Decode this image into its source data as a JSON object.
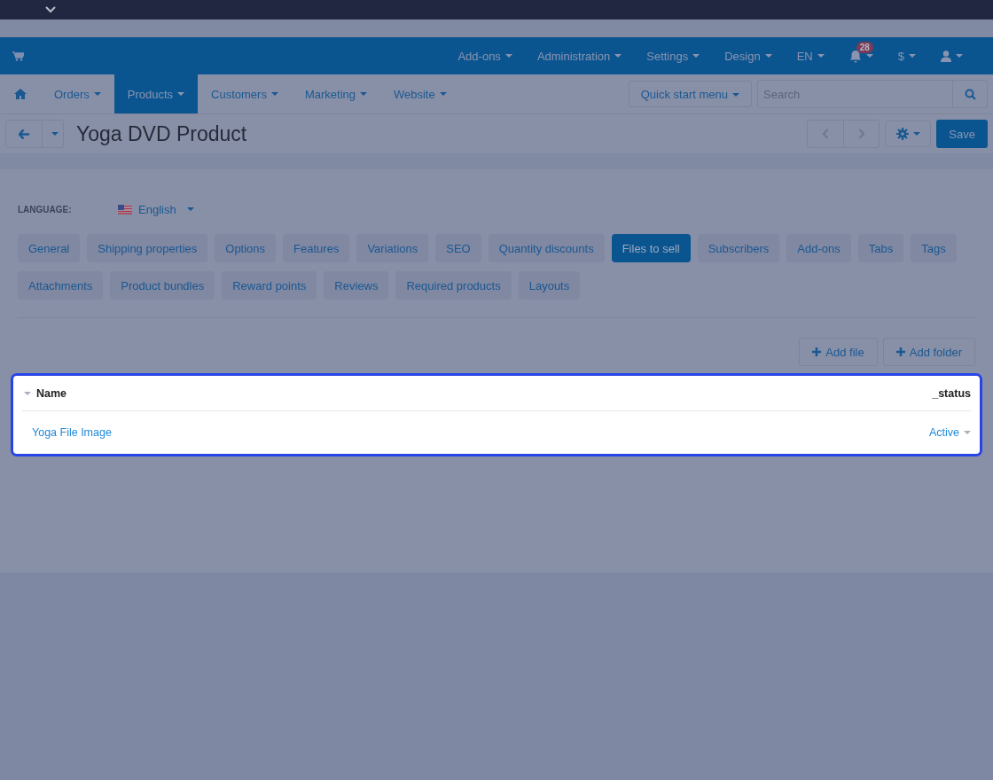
{
  "top_nav": {
    "items": [
      {
        "label": "Add-ons"
      },
      {
        "label": "Administration"
      },
      {
        "label": "Settings"
      },
      {
        "label": "Design"
      },
      {
        "label": "EN"
      }
    ],
    "notifications_badge": "28",
    "currency": "$"
  },
  "main_nav": {
    "items": [
      {
        "label": "Orders",
        "selected": false
      },
      {
        "label": "Products",
        "selected": true
      },
      {
        "label": "Customers",
        "selected": false
      },
      {
        "label": "Marketing",
        "selected": false
      },
      {
        "label": "Website",
        "selected": false
      }
    ],
    "quick_start": "Quick start menu",
    "search": {
      "placeholder": "Search"
    }
  },
  "page_title": "Yoga DVD Product",
  "save_button": "Save",
  "language": {
    "label": "LANGUAGE:",
    "value": "English"
  },
  "tabs": [
    {
      "label": "General",
      "selected": false
    },
    {
      "label": "Shipping properties",
      "selected": false
    },
    {
      "label": "Options",
      "selected": false
    },
    {
      "label": "Features",
      "selected": false
    },
    {
      "label": "Variations",
      "selected": false
    },
    {
      "label": "SEO",
      "selected": false
    },
    {
      "label": "Quantity discounts",
      "selected": false
    },
    {
      "label": "Files to sell",
      "selected": true
    },
    {
      "label": "Subscribers",
      "selected": false
    },
    {
      "label": "Add-ons",
      "selected": false
    },
    {
      "label": "Tabs",
      "selected": false
    },
    {
      "label": "Tags",
      "selected": false
    },
    {
      "label": "Attachments",
      "selected": false
    },
    {
      "label": "Product bundles",
      "selected": false
    },
    {
      "label": "Reward points",
      "selected": false
    },
    {
      "label": "Reviews",
      "selected": false
    },
    {
      "label": "Required products",
      "selected": false
    },
    {
      "label": "Layouts",
      "selected": false
    }
  ],
  "actions": [
    "Add file",
    "Add folder"
  ],
  "table": {
    "columns": [
      "Name",
      "_status"
    ],
    "rows": [
      {
        "name": "Yoga File Image",
        "status": "Active"
      }
    ]
  }
}
